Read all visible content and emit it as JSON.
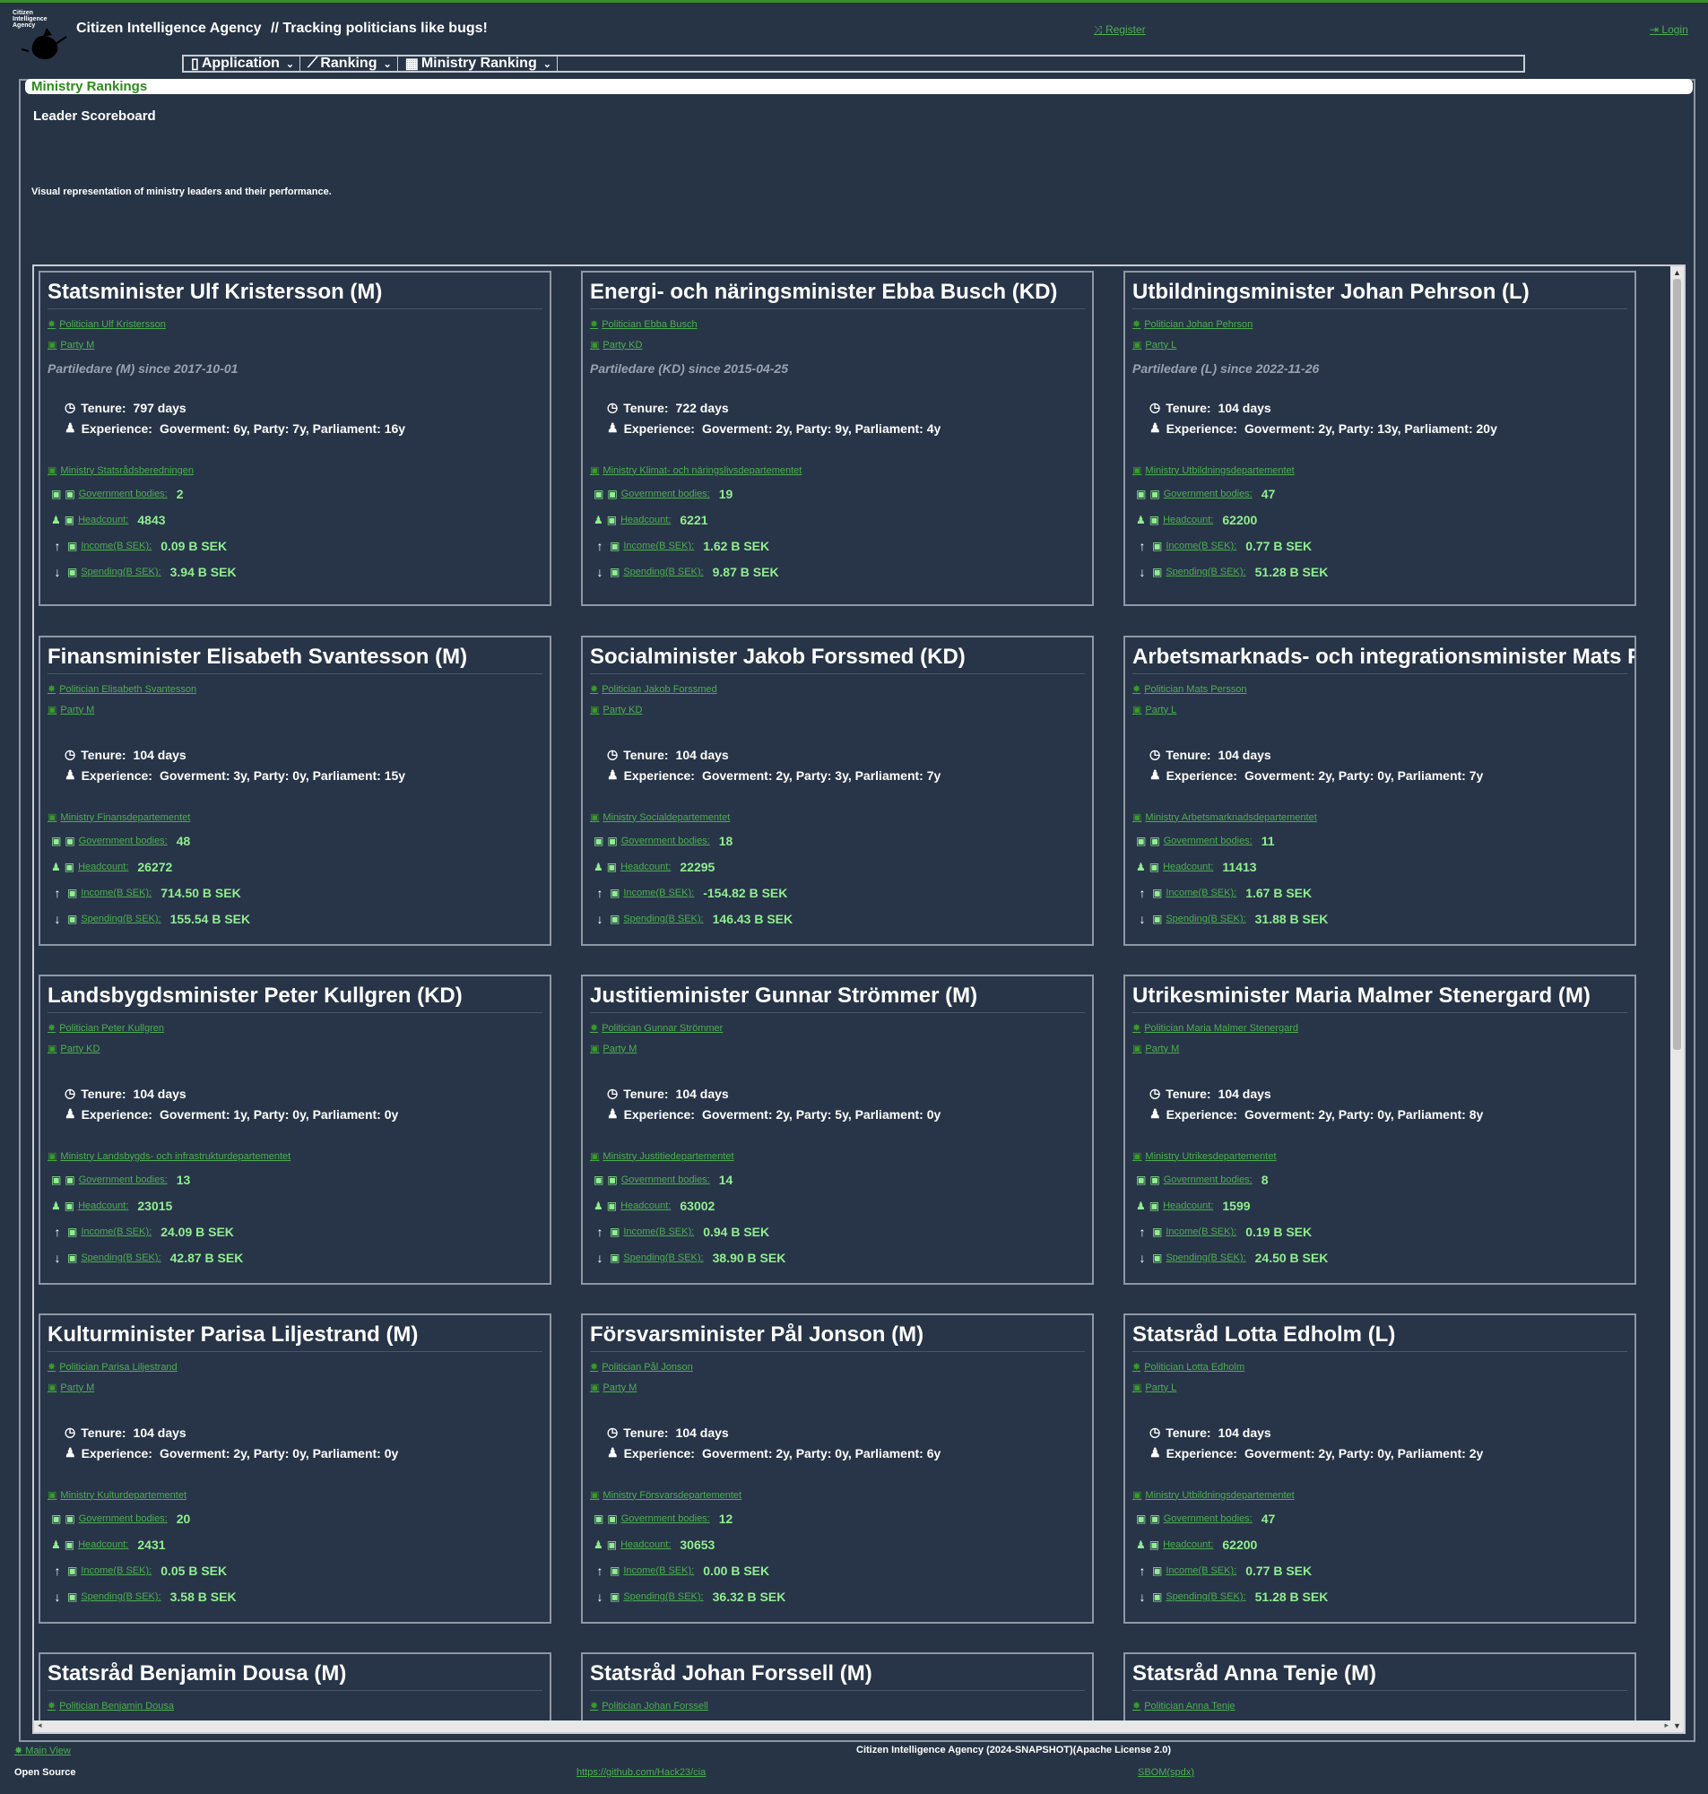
{
  "header": {
    "logo_text": "Citizen Intelligence Agency",
    "app_name": "Citizen Intelligence Agency",
    "tagline": "// Tracking politicians like bugs!",
    "register": "Register",
    "login": "Login"
  },
  "menu": [
    {
      "label": "Application",
      "icon": "document-icon"
    },
    {
      "label": "Ranking",
      "icon": "chart-icon"
    },
    {
      "label": "Ministry Ranking",
      "icon": "building-icon"
    }
  ],
  "page": {
    "panel_title": "Ministry Rankings",
    "section_title": "Leader Scoreboard",
    "description": "Visual representation of ministry leaders and their performance."
  },
  "labels": {
    "tenure": "Tenure:",
    "experience": "Experience:",
    "gov_bodies": "Government bodies:",
    "headcount": "Headcount:",
    "income": "Income(B SEK):",
    "spending": "Spending(B SEK):"
  },
  "cards": [
    {
      "title": "Statsminister Ulf Kristersson (M)",
      "politician": "Politician Ulf Kristersson",
      "party": "Party M",
      "since": "Partiledare (M) since 2017-10-01",
      "tenure": "797 days",
      "experience": "Goverment: 6y, Party: 7y, Parliament: 16y",
      "ministry": "Ministry Statsrådsberedningen",
      "gov_bodies": "2",
      "headcount": "4843",
      "income": "0.09 B SEK",
      "spending": "3.94 B SEK"
    },
    {
      "title": "Energi- och näringsminister Ebba Busch (KD)",
      "politician": "Politician Ebba Busch",
      "party": "Party KD",
      "since": "Partiledare (KD) since 2015-04-25",
      "tenure": "722 days",
      "experience": "Goverment: 2y, Party: 9y, Parliament: 4y",
      "ministry": "Ministry Klimat- och näringslivsdepartementet",
      "gov_bodies": "19",
      "headcount": "6221",
      "income": "1.62 B SEK",
      "spending": "9.87 B SEK"
    },
    {
      "title": "Utbildningsminister Johan Pehrson (L)",
      "politician": "Politician Johan Pehrson",
      "party": "Party L",
      "since": "Partiledare (L) since 2022-11-26",
      "tenure": "104 days",
      "experience": "Goverment: 2y, Party: 13y, Parliament: 20y",
      "ministry": "Ministry Utbildningsdepartementet",
      "gov_bodies": "47",
      "headcount": "62200",
      "income": "0.77 B SEK",
      "spending": "51.28 B SEK"
    },
    {
      "title": "Finansminister Elisabeth Svantesson (M)",
      "politician": "Politician Elisabeth Svantesson",
      "party": "Party M",
      "since": "",
      "tenure": "104 days",
      "experience": "Goverment: 3y, Party: 0y, Parliament: 15y",
      "ministry": "Ministry Finansdepartementet",
      "gov_bodies": "48",
      "headcount": "26272",
      "income": "714.50 B SEK",
      "spending": "155.54 B SEK"
    },
    {
      "title": "Socialminister Jakob Forssmed (KD)",
      "politician": "Politician Jakob Forssmed",
      "party": "Party KD",
      "since": "",
      "tenure": "104 days",
      "experience": "Goverment: 2y, Party: 3y, Parliament: 7y",
      "ministry": "Ministry Socialdepartementet",
      "gov_bodies": "18",
      "headcount": "22295",
      "income": "-154.82 B SEK",
      "spending": "146.43 B SEK"
    },
    {
      "title": "Arbetsmarknads- och integrationsminister Mats Persson (L)",
      "politician": "Politician Mats Persson",
      "party": "Party L",
      "since": "",
      "tenure": "104 days",
      "experience": "Goverment: 2y, Party: 0y, Parliament: 7y",
      "ministry": "Ministry Arbetsmarknadsdepartementet",
      "gov_bodies": "11",
      "headcount": "11413",
      "income": "1.67 B SEK",
      "spending": "31.88 B SEK"
    },
    {
      "title": "Landsbygdsminister Peter Kullgren (KD)",
      "politician": "Politician Peter Kullgren",
      "party": "Party KD",
      "since": "",
      "tenure": "104 days",
      "experience": "Goverment: 1y, Party: 0y, Parliament: 0y",
      "ministry": "Ministry Landsbygds- och infrastrukturdepartementet",
      "gov_bodies": "13",
      "headcount": "23015",
      "income": "24.09 B SEK",
      "spending": "42.87 B SEK"
    },
    {
      "title": "Justitieminister Gunnar Strömmer (M)",
      "politician": "Politician Gunnar Strömmer",
      "party": "Party M",
      "since": "",
      "tenure": "104 days",
      "experience": "Goverment: 2y, Party: 5y, Parliament: 0y",
      "ministry": "Ministry Justitiedepartementet",
      "gov_bodies": "14",
      "headcount": "63002",
      "income": "0.94 B SEK",
      "spending": "38.90 B SEK"
    },
    {
      "title": "Utrikesminister Maria Malmer Stenergard (M)",
      "politician": "Politician Maria Malmer Stenergard",
      "party": "Party M",
      "since": "",
      "tenure": "104 days",
      "experience": "Goverment: 2y, Party: 0y, Parliament: 8y",
      "ministry": "Ministry Utrikesdepartementet",
      "gov_bodies": "8",
      "headcount": "1599",
      "income": "0.19 B SEK",
      "spending": "24.50 B SEK"
    },
    {
      "title": "Kulturminister Parisa Liljestrand (M)",
      "politician": "Politician Parisa Liljestrand",
      "party": "Party M",
      "since": "",
      "tenure": "104 days",
      "experience": "Goverment: 2y, Party: 0y, Parliament: 0y",
      "ministry": "Ministry Kulturdepartementet",
      "gov_bodies": "20",
      "headcount": "2431",
      "income": "0.05 B SEK",
      "spending": "3.58 B SEK"
    },
    {
      "title": "Försvarsminister Pål Jonson (M)",
      "politician": "Politician Pål Jonson",
      "party": "Party M",
      "since": "",
      "tenure": "104 days",
      "experience": "Goverment: 2y, Party: 0y, Parliament: 6y",
      "ministry": "Ministry Försvarsdepartementet",
      "gov_bodies": "12",
      "headcount": "30653",
      "income": "0.00 B SEK",
      "spending": "36.32 B SEK"
    },
    {
      "title": "Statsråd Lotta Edholm (L)",
      "politician": "Politician Lotta Edholm",
      "party": "Party L",
      "since": "",
      "tenure": "104 days",
      "experience": "Goverment: 2y, Party: 0y, Parliament: 2y",
      "ministry": "Ministry Utbildningsdepartementet",
      "gov_bodies": "47",
      "headcount": "62200",
      "income": "0.77 B SEK",
      "spending": "51.28 B SEK"
    },
    {
      "title": "Statsråd Benjamin Dousa (M)",
      "politician": "Politician Benjamin Dousa",
      "party": "",
      "since": "",
      "tenure": "",
      "experience": "",
      "ministry": "",
      "gov_bodies": "",
      "headcount": "",
      "income": "",
      "spending": ""
    },
    {
      "title": "Statsråd Johan Forssell (M)",
      "politician": "Politician Johan Forssell",
      "party": "",
      "since": "",
      "tenure": "",
      "experience": "",
      "ministry": "",
      "gov_bodies": "",
      "headcount": "",
      "income": "",
      "spending": ""
    },
    {
      "title": "Statsråd Anna Tenje (M)",
      "politician": "Politician Anna Tenje",
      "party": "",
      "since": "",
      "tenure": "",
      "experience": "",
      "ministry": "",
      "gov_bodies": "",
      "headcount": "",
      "income": "",
      "spending": ""
    }
  ],
  "footer": {
    "main_view": "Main View",
    "version": "Citizen Intelligence Agency (2024-SNAPSHOT)(Apache License 2.0)",
    "open_source": "Open Source",
    "github": "https://github.com/Hack23/cia",
    "sbom": "SBOM(spdx)"
  }
}
